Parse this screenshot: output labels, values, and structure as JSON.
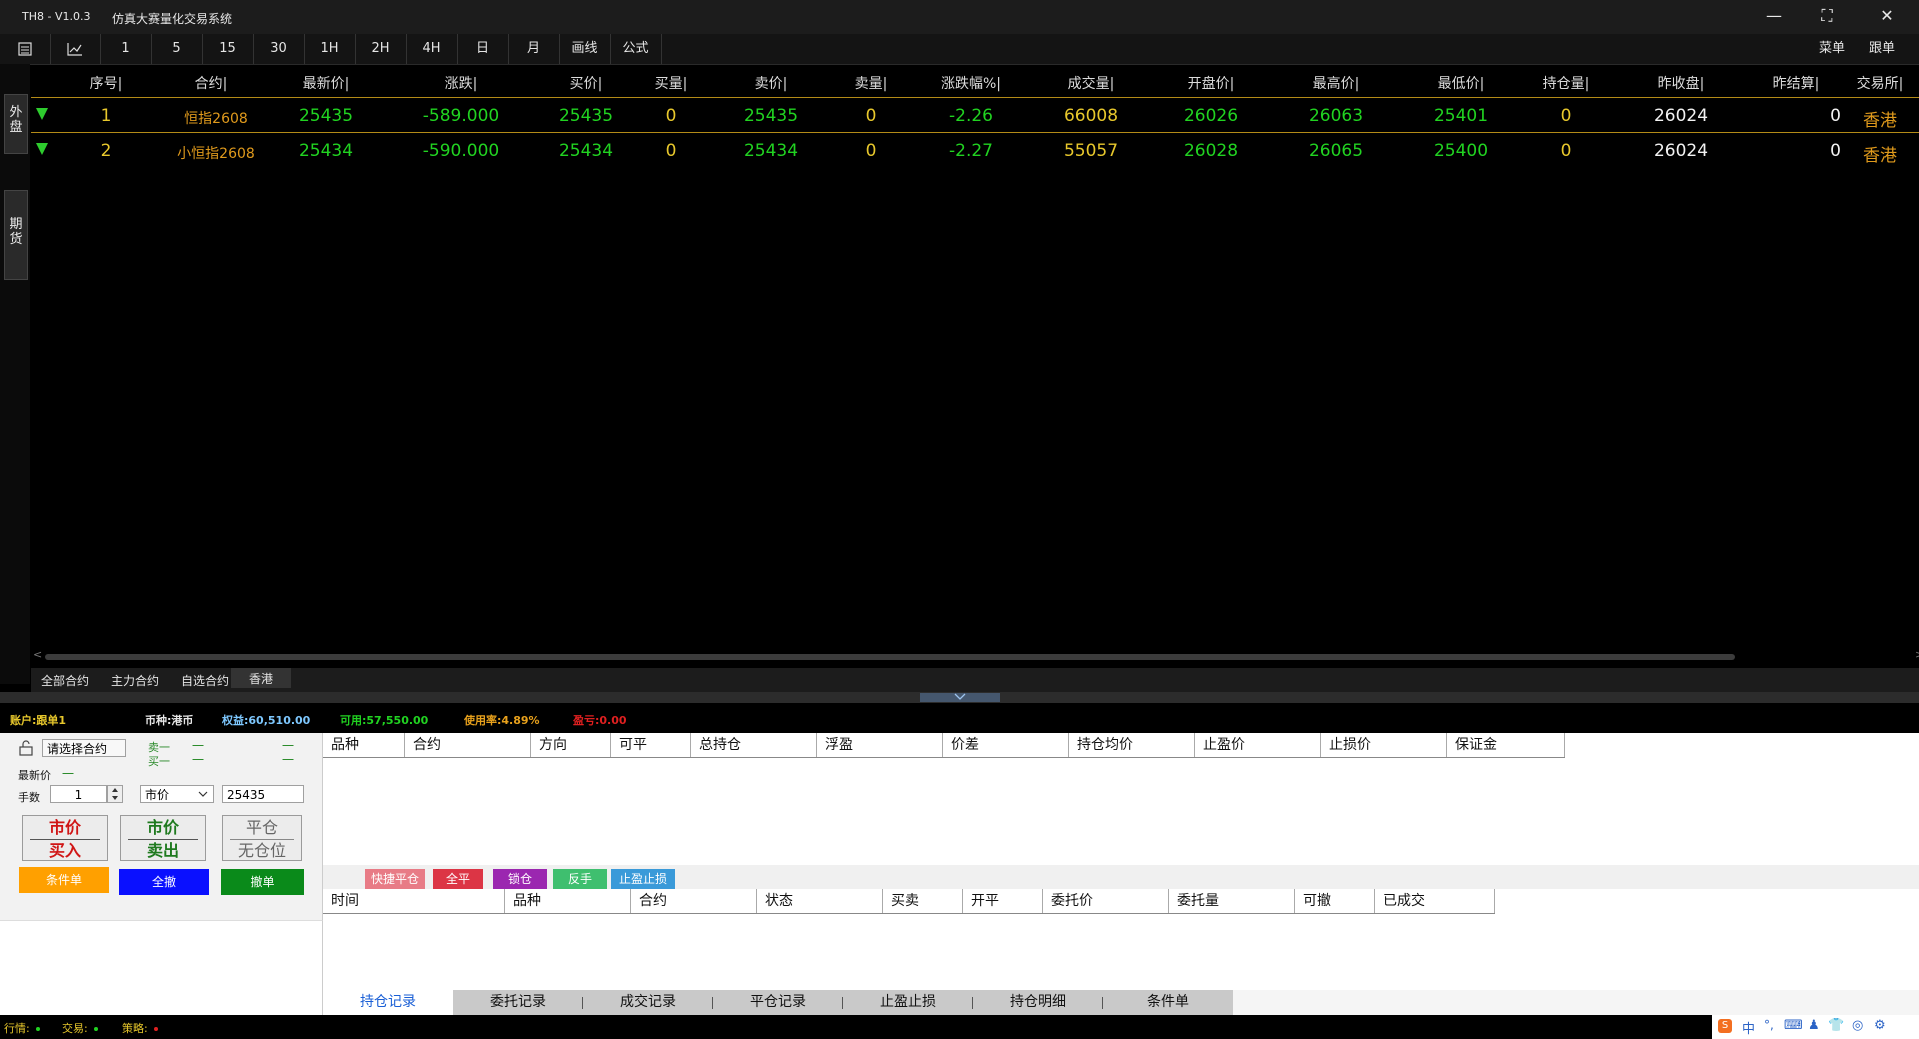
{
  "window": {
    "app_id": "TH8 - V1.0.3",
    "title": "仿真大赛量化交易系统",
    "controls": {
      "minimize": "—",
      "maximize": "⛶",
      "close": "✕"
    }
  },
  "toolbar": {
    "items": [
      "1",
      "5",
      "15",
      "30",
      "1H",
      "2H",
      "4H",
      "日",
      "月",
      "画线",
      "公式"
    ],
    "right": [
      "菜单",
      "跟单"
    ]
  },
  "side_tabs": [
    "外盘",
    "期货"
  ],
  "quote_table": {
    "headers": [
      "序号|",
      "合约|",
      "最新价|",
      "涨跌|",
      "买价|",
      "买量|",
      "卖价|",
      "卖量|",
      "涨跌幅%|",
      "成交量|",
      "开盘价|",
      "最高价|",
      "最低价|",
      "持仓量|",
      "昨收盘|",
      "昨结算|",
      "交易所|"
    ],
    "rows": [
      {
        "direction": "down",
        "cells": [
          "1",
          "恒指2608",
          "25435",
          "-589.000",
          "25435",
          "0",
          "25435",
          "0",
          "-2.26",
          "66008",
          "26026",
          "26063",
          "25401",
          "0",
          "26024",
          "0",
          "香港"
        ]
      },
      {
        "direction": "down",
        "cells": [
          "2",
          "小恒指2608",
          "25434",
          "-590.000",
          "25434",
          "0",
          "25434",
          "0",
          "-2.27",
          "55057",
          "26028",
          "26065",
          "25400",
          "0",
          "26024",
          "0",
          "香港"
        ]
      }
    ],
    "scroll_left": "<",
    "scroll_right": ">"
  },
  "category_tabs": [
    "全部合约",
    "主力合约",
    "自选合约",
    "香港"
  ],
  "account_bar": {
    "account": "账户:跟单1",
    "currency": "币种:港币",
    "equity": "权益:60,510.00",
    "available": "可用:57,550.00",
    "usage": "使用率:4.89%",
    "pnl": "盈亏:0.00"
  },
  "order_panel": {
    "contract_placeholder": "请选择合约",
    "sell1": "卖一",
    "buy1": "买一",
    "dash": "一",
    "latest_label": "最新价",
    "latest_value": "一",
    "lots_label": "手数",
    "lots_value": "1",
    "price_type": "市价",
    "price_value": "25435",
    "buy_btn": {
      "l1": "市价",
      "l2": "买入"
    },
    "sell_btn": {
      "l1": "市价",
      "l2": "卖出"
    },
    "close_btn": {
      "l1": "平仓",
      "l2": "无仓位"
    },
    "cond_btn": "条件单",
    "cancel_all_btn": "全撤",
    "cancel_btn": "撤单"
  },
  "positions": {
    "headers": [
      "品种",
      "合约",
      "方向",
      "可平",
      "总持仓",
      "浮盈",
      "价差",
      "持仓均价",
      "止盈价",
      "止损价",
      "保证金"
    ]
  },
  "actions": [
    {
      "label": "快捷平仓",
      "color": "#e87b86"
    },
    {
      "label": "全平",
      "color": "#dc3545"
    },
    {
      "label": "锁仓",
      "color": "#9b27b0"
    },
    {
      "label": "反手",
      "color": "#3fbf6f"
    },
    {
      "label": "止盈止损",
      "color": "#3a9ad9"
    }
  ],
  "orders": {
    "headers": [
      "时间",
      "品种",
      "合约",
      "状态",
      "买卖",
      "开平",
      "委托价",
      "委托量",
      "可撤",
      "已成交"
    ]
  },
  "bottom_tabs": [
    "持仓记录",
    "委托记录",
    "成交记录",
    "平仓记录",
    "止盈止损",
    "持仓明细",
    "条件单"
  ],
  "status_bar": {
    "market": "行情:",
    "trade": "交易:",
    "strategy": "策略:",
    "colors": {
      "market": "#21d321",
      "trade": "#21d321",
      "strategy": "#e02020"
    }
  },
  "ime_tray": [
    "中",
    "°,",
    "⌨",
    "♟",
    "👕",
    "◎",
    "⚙"
  ]
}
